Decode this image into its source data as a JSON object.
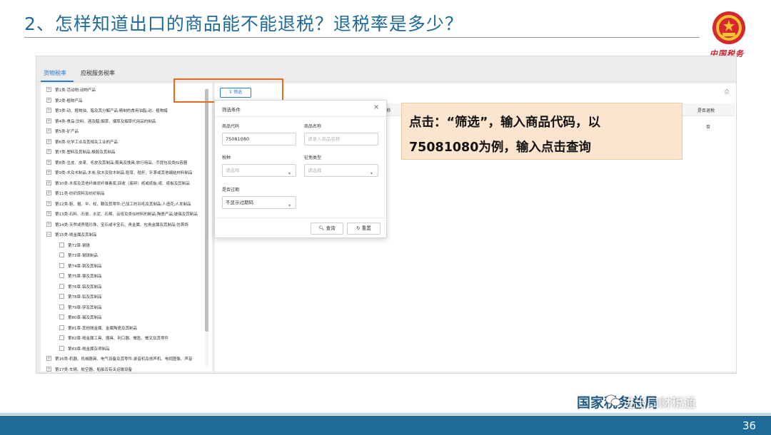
{
  "slide": {
    "title": "2、怎样知道出口的商品能不能退税？退税率是多少？",
    "tax_logo_text": "中国税务",
    "brand": "国家税务总局",
    "watermark": "进出口财税通",
    "page_number": "36"
  },
  "tabs": [
    {
      "label": "货物税率"
    },
    {
      "label": "应税服务税率"
    }
  ],
  "tree": {
    "rows": [
      {
        "toggle": "+",
        "label": "第1类-活动物;动物产品"
      },
      {
        "toggle": "+",
        "label": "第2类-植物产品"
      },
      {
        "toggle": "+",
        "label": "第3类-动、植物油、脂及其分解产品;精制的食用油脂;动、植物蜡"
      },
      {
        "toggle": "+",
        "label": "第4类-食品;饮料、酒及醋;烟草、烟草及烟草代用品的制品"
      },
      {
        "toggle": "+",
        "label": "第5类-矿产品"
      },
      {
        "toggle": "+",
        "label": "第6类-化学工业及其相关工业的产品"
      },
      {
        "toggle": "+",
        "label": "第7类-塑料及其制品;橡胶及其制品"
      },
      {
        "toggle": "+",
        "label": "第8类-生皮、皮革、毛皮及其制品;鞍具及挽具;旅行用品、手提包及类似容器"
      },
      {
        "toggle": "+",
        "label": "第9类-木及木制品;木炭;软木及软木制品;稻草、秸秆、针茅或其他编结材料制品"
      },
      {
        "toggle": "+",
        "label": "第10类-木浆及其他纤维状纤维素浆;回收（废碎）纸或纸板;纸、纸板及其制品"
      },
      {
        "toggle": "+",
        "label": "第11类-纺织原料及纺织制品"
      },
      {
        "toggle": "+",
        "label": "第12类-鞋、帽、伞、杖、鞭及其零件;已加工的羽毛及其制品;人造花;人发制品"
      },
      {
        "toggle": "+",
        "label": "第13类-石料、石膏、水泥、石棉、云母及类似材料的制品;陶瓷产品;玻璃及其制品"
      },
      {
        "toggle": "+",
        "label": "第14类-天然或养殖珍珠、宝石或半宝石、贵金属、包贵金属及其制品;仿首饰"
      },
      {
        "toggle": "−",
        "label": "第15类-贱金属及其制品"
      },
      {
        "child": true,
        "label": "第72章-钢铁"
      },
      {
        "child": true,
        "label": "第73章-钢铁制品"
      },
      {
        "child": true,
        "label": "第74章-铜及其制品"
      },
      {
        "child": true,
        "label": "第75章-镍及其制品"
      },
      {
        "child": true,
        "label": "第76章-铝及其制品"
      },
      {
        "child": true,
        "label": "第78章-铅及其制品"
      },
      {
        "child": true,
        "label": "第79章-锌及其制品"
      },
      {
        "child": true,
        "label": "第80章-锡及其制品"
      },
      {
        "child": true,
        "label": "第81章-其他贱金属、金属陶瓷及其制品"
      },
      {
        "child": true,
        "label": "第82章-贱金属工具、器具、利口器、餐匙、餐叉及其零件"
      },
      {
        "child": true,
        "label": "第83章-贱金属杂项制品"
      },
      {
        "toggle": "+",
        "label": "第16类-机器、机械器具、电气设备及其零件;录音机及放声机、电视图像、声音"
      },
      {
        "toggle": "+",
        "label": "第17类-车辆、航空器、船舶及有关运输设备"
      }
    ]
  },
  "main": {
    "filter_label": "筛选",
    "columns": {
      "name_partial": "称",
      "refund": "是否退税"
    },
    "first_row_refund": "否"
  },
  "dialog": {
    "title": "筛选条件",
    "close": "×",
    "product_code_label": "商品代码",
    "product_code_value": "75081080",
    "product_name_label": "商品名称",
    "product_name_placeholder": "请录入商品名称",
    "tax_type_label": "税种",
    "tax_type_placeholder": "请选择",
    "exemption_type_label": "征免类型",
    "exemption_type_placeholder": "请选择",
    "expired_label": "是否过期",
    "expired_value": "不显示过期码",
    "query_button": "查询",
    "reset_button": "重置"
  },
  "callout": {
    "line1": "点击：“筛选”，输入商品代码，以",
    "line2": "75081080为例，输入点击查询"
  },
  "colors": {
    "title_blue": "#1e6a99",
    "accent_orange": "#e86a1a",
    "callout_bg": "#fbe5cf",
    "link_blue": "#2b7bd6"
  }
}
